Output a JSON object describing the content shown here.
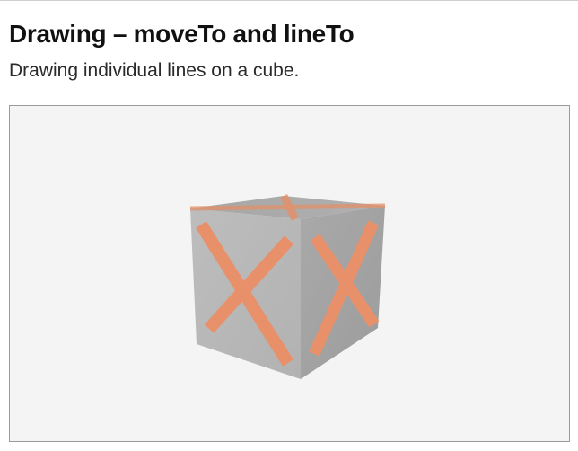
{
  "page": {
    "title": "Drawing – moveTo and lineTo",
    "subtitle": "Drawing individual lines on a cube."
  },
  "scene": {
    "background_color": "#f4f4f4",
    "cube_colors": {
      "top": "#a8a8a8",
      "front": "#b9b9b9",
      "right": "#a3a3a3"
    },
    "line_color": "#e8906a"
  }
}
